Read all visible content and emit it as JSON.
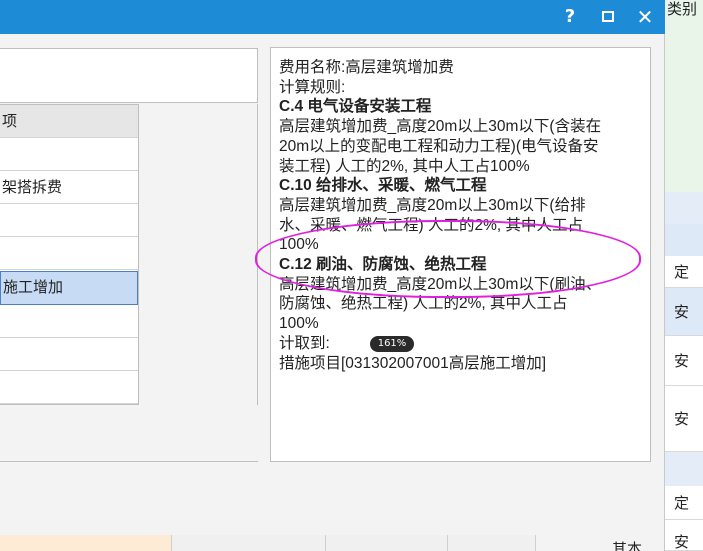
{
  "titlebar": {
    "help": "?",
    "close": "✕"
  },
  "top_right_label": "类别",
  "grid": {
    "header": "项",
    "rows": [
      "",
      "架搭拆费",
      "",
      "",
      "施工增加",
      "",
      "",
      ""
    ]
  },
  "info": {
    "lines": [
      {
        "text": "费用名称:高层建筑增加费",
        "bold": false
      },
      {
        "text": "计算规则:",
        "bold": false
      },
      {
        "text": "C.4 电气设备安装工程",
        "bold": true
      },
      {
        "text": "高层建筑增加费_高度20m以上30m以下(含装在",
        "bold": false
      },
      {
        "text": "20m以上的变配电工程和动力工程)(电气设备安",
        "bold": false
      },
      {
        "text": "装工程) 人工的2%, 其中人工占100%",
        "bold": false
      },
      {
        "text": "C.10 给排水、采暖、燃气工程",
        "bold": true
      },
      {
        "text": "高层建筑增加费_高度20m以上30m以下(给排",
        "bold": false
      },
      {
        "text": "水、采暖、燃气工程) 人工的2%, 其中人工占",
        "bold": false
      },
      {
        "text": "100%",
        "bold": false
      },
      {
        "text": "C.12 刷油、防腐蚀、绝热工程",
        "bold": true
      },
      {
        "text": "高层建筑增加费_高度20m以上30m以下(刷油、",
        "bold": false
      },
      {
        "text": "防腐蚀、绝热工程) 人工的2%, 其中人工占",
        "bold": false
      },
      {
        "text": "100%",
        "bold": false
      },
      {
        "text": "计取到:",
        "bold": false
      },
      {
        "text": "措施项目[031302007001高层施工增加]",
        "bold": false
      }
    ]
  },
  "zoom_badge": "161%",
  "right_strip": [
    "定",
    "安",
    "安",
    "安",
    "定",
    "安"
  ],
  "footer_label": "其本"
}
